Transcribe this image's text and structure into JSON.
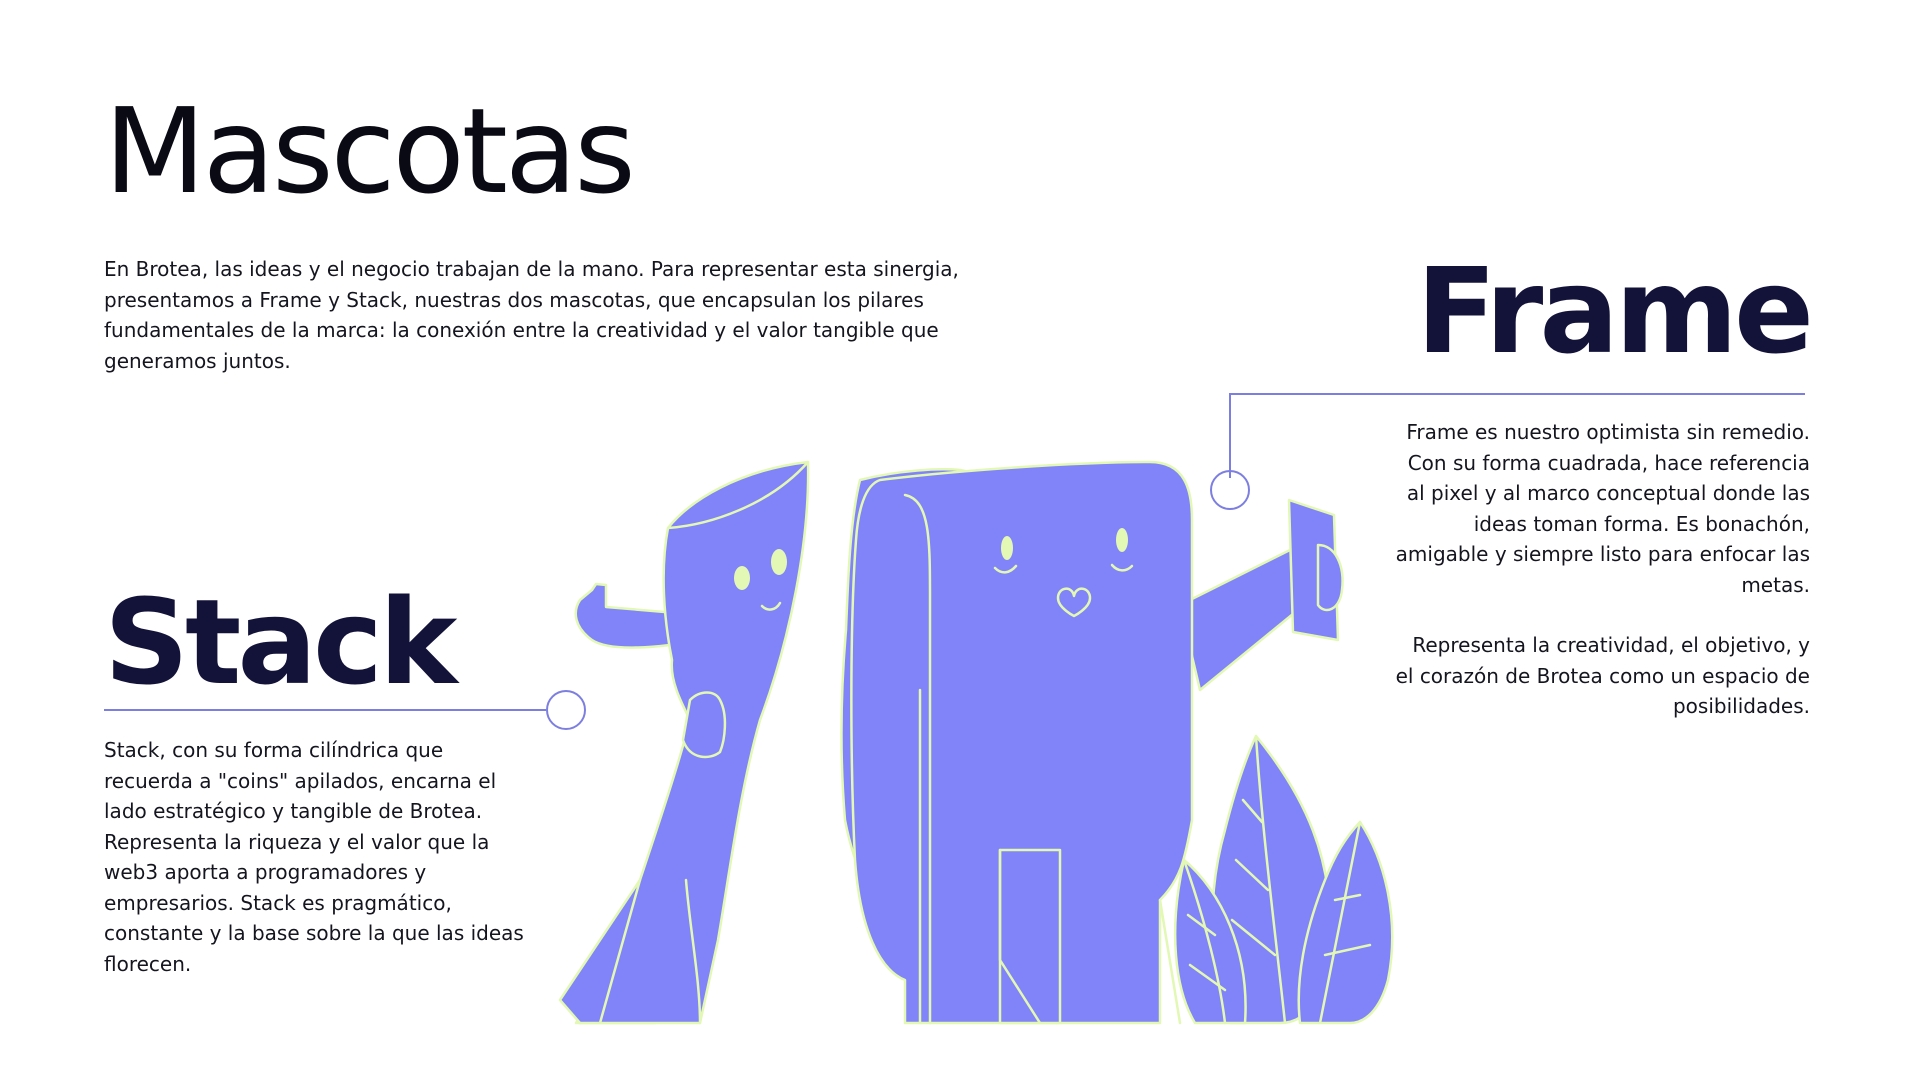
{
  "page": {
    "title": "Mascotas",
    "intro": "En Brotea, las ideas y el negocio trabajan de la mano. Para representar esta sinergia, presentamos a Frame y Stack, nuestras dos mascotas, que encapsulan los pilares fundamentales de la marca: la conexión entre la creatividad y el valor tangible que generamos juntos."
  },
  "frame": {
    "name": "Frame",
    "description": [
      "Frame es nuestro optimista sin remedio. Con su forma cuadrada, hace referencia al pixel y al marco conceptual donde las ideas toman forma. Es bonachón, amigable y siempre listo para enfocar las metas.",
      "Representa la creatividad, el objetivo, y el corazón de Brotea como un espacio de posibilidades."
    ]
  },
  "stack": {
    "name": "Stack",
    "description": "Stack, con su forma cilíndrica que recuerda a \"coins\" apilados, encarna el lado estratégico y tangible de Brotea. Representa la riqueza y el valor que la web3 aporta a programadores y empresarios. Stack es pragmático, constante y la base sobre la que las ideas florecen."
  },
  "colors": {
    "mascot_fill": "#8183f8",
    "mascot_outline": "#e2f8b4",
    "connector_line": "#7d7fe0",
    "eye_color": "#e2f8b4"
  },
  "icons": [
    "frame-mascot-illustration",
    "stack-mascot-illustration",
    "leaves-illustration"
  ]
}
